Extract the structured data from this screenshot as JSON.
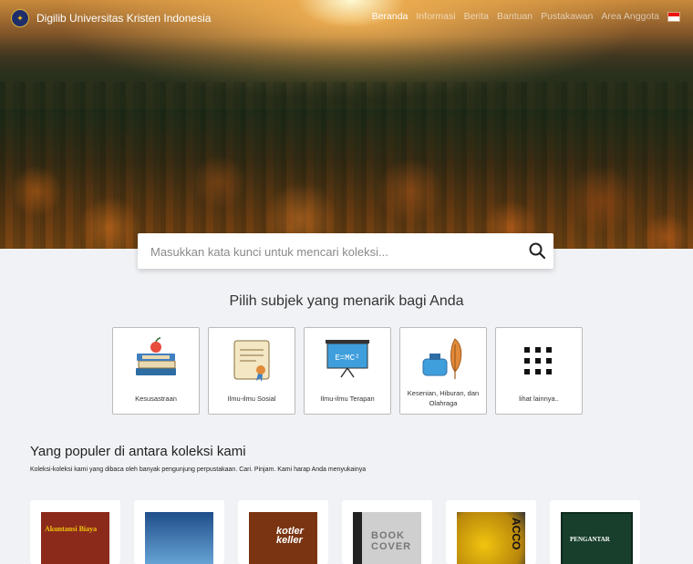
{
  "header": {
    "brand": "Digilib Universitas Kristen Indonesia",
    "nav": [
      "Beranda",
      "Informasi",
      "Berita",
      "Bantuan",
      "Pustakawan",
      "Area Anggota"
    ]
  },
  "search": {
    "placeholder": "Masukkan kata kunci untuk mencari koleksi..."
  },
  "subjects": {
    "title": "Pilih subjek yang menarik bagi Anda",
    "items": [
      "Kesusastraan",
      "Ilmu-ilmu Sosial",
      "Ilmu-ilmu Terapan",
      "Kesenian, Hiburan, dan Olahraga",
      "lihat lainnya.."
    ],
    "formula": "E=MC²"
  },
  "popular": {
    "title": "Yang populer di antara koleksi kami",
    "subtitle": "Koleksi-koleksi kami yang dibaca oleh banyak pengunjung perpustakaan. Cari. Pinjam. Kami harap Anda menyukainya",
    "book_cover_texts": [
      "Akuntansi Biaya",
      "",
      "kotler keller",
      "BOOK COVER",
      "ACCO",
      "PENGANTAR"
    ]
  },
  "colors": {
    "accent_red": "#e74c3c",
    "book_blue": "#2e6da4",
    "book_green": "#173f2c"
  }
}
